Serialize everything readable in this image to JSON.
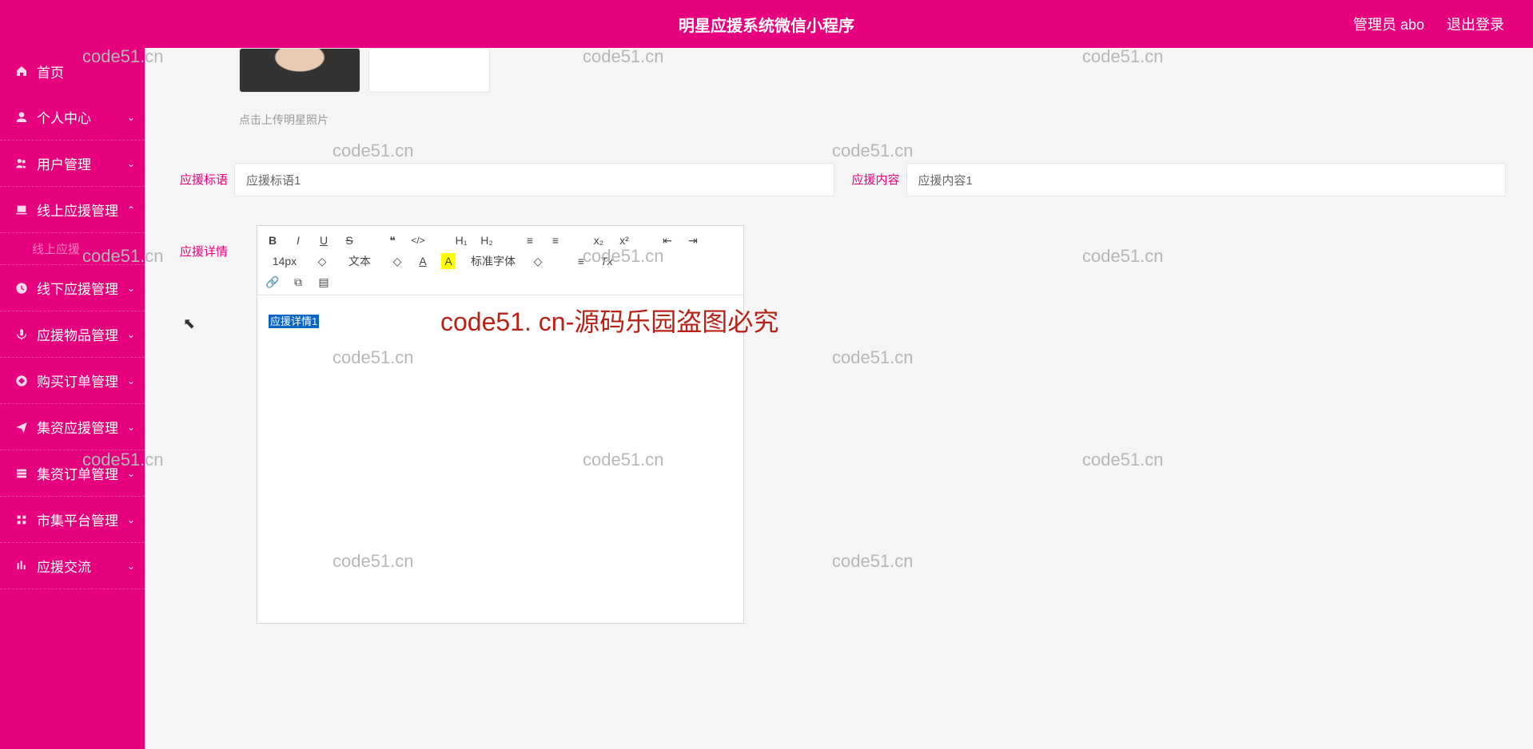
{
  "header": {
    "title": "明星应援系统微信小程序",
    "admin_label": "管理员 abo",
    "logout": "退出登录"
  },
  "sidebar": {
    "items": [
      {
        "label": "首页",
        "icon": "home-icon",
        "expand": ""
      },
      {
        "label": "个人中心",
        "icon": "user-icon",
        "expand": "v"
      },
      {
        "label": "用户管理",
        "icon": "users-icon",
        "expand": "v"
      },
      {
        "label": "线上应援管理",
        "icon": "online-icon",
        "expand": "^"
      },
      {
        "label": "线下应援管理",
        "icon": "clock-icon",
        "expand": "v"
      },
      {
        "label": "应援物品管理",
        "icon": "mic-icon",
        "expand": "v"
      },
      {
        "label": "购买订单管理",
        "icon": "cart-icon",
        "expand": "v"
      },
      {
        "label": "集资应援管理",
        "icon": "send-icon",
        "expand": "v"
      },
      {
        "label": "集资订单管理",
        "icon": "list-icon",
        "expand": "v"
      },
      {
        "label": "市集平台管理",
        "icon": "market-icon",
        "expand": "v"
      },
      {
        "label": "应援交流",
        "icon": "bars-icon",
        "expand": "v"
      }
    ],
    "sub_active": "线上应援"
  },
  "form": {
    "upload_hint": "点击上传明星照片",
    "slogan_label": "应援标语",
    "slogan_value": "应援标语1",
    "content_label": "应援内容",
    "content_value": "应援内容1",
    "detail_label": "应援详情",
    "detail_value": "应援详情1"
  },
  "editor_toolbar": {
    "font_size": "14px",
    "block_type": "文本",
    "font_family": "标准字体",
    "btn_bold": "B",
    "btn_italic": "I",
    "btn_underline": "U",
    "btn_strike": "S",
    "btn_quote": "❝",
    "btn_code": "</>",
    "btn_h1": "H₁",
    "btn_h2": "H₂",
    "btn_ol": "≡",
    "btn_ul": "≡",
    "btn_sub": "x₂",
    "btn_sup": "x²",
    "btn_indent": "⇤",
    "btn_outdent": "⇥",
    "caret": "◇",
    "btn_fg": "A",
    "btn_bg": "A",
    "btn_align": "≡",
    "btn_clear": "Tx",
    "btn_link": "🔗",
    "btn_image": "⧉",
    "btn_save": "▤"
  },
  "watermarks": {
    "text": "code51.cn",
    "red": "code51. cn-源码乐园盗图必究"
  }
}
